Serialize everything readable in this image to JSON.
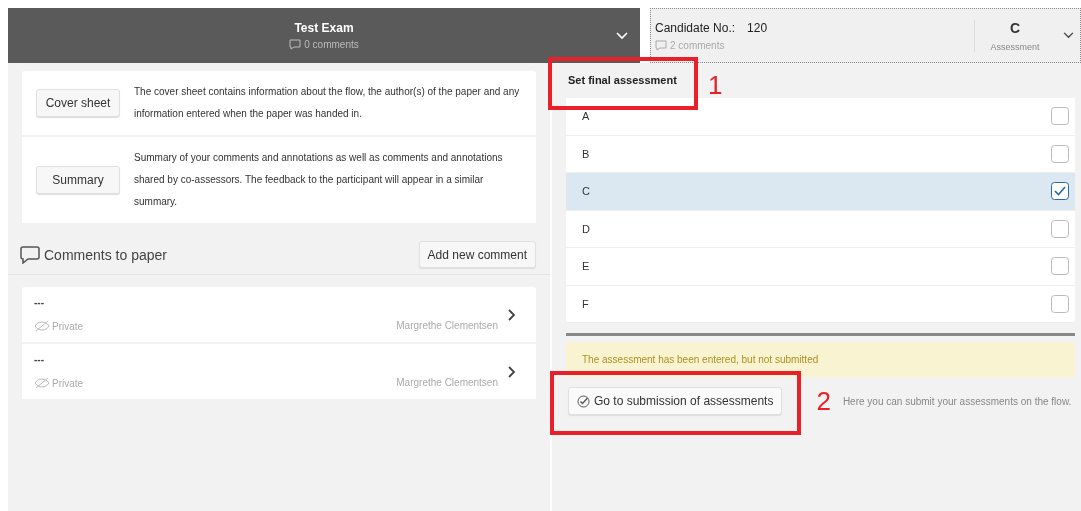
{
  "header": {
    "title": "Test Exam",
    "comments": "0 comments"
  },
  "candidate": {
    "label": "Candidate No.:",
    "number": "120",
    "comments": "2 comments",
    "grade": "C",
    "grade_label": "Assessment"
  },
  "documents": [
    {
      "button": "Cover sheet",
      "description": "The cover sheet contains information about the flow, the author(s) of the paper and any information entered when the paper was handed in."
    },
    {
      "button": "Summary",
      "description": "Summary of your comments and annotations as well as comments and annotations shared by co-assessors. The feedback to the participant will appear in a similar summary."
    }
  ],
  "comments_section": {
    "title": "Comments to paper",
    "add_button": "Add new comment"
  },
  "comments": [
    {
      "text": "---",
      "visibility": "Private",
      "author": "Margrethe Clementsen"
    },
    {
      "text": "---",
      "visibility": "Private",
      "author": "Margrethe Clementsen"
    }
  ],
  "assessment": {
    "title": "Set final assessment",
    "options": [
      {
        "label": "A",
        "selected": false
      },
      {
        "label": "B",
        "selected": false
      },
      {
        "label": "C",
        "selected": true
      },
      {
        "label": "D",
        "selected": false
      },
      {
        "label": "E",
        "selected": false
      },
      {
        "label": "F",
        "selected": false
      }
    ],
    "notice": "The assessment has been entered, but not submitted",
    "submit_button": "Go to submission of assessments",
    "help": "Here you can submit your assessments on the flow."
  },
  "annotations": [
    {
      "number": "1"
    },
    {
      "number": "2"
    }
  ]
}
